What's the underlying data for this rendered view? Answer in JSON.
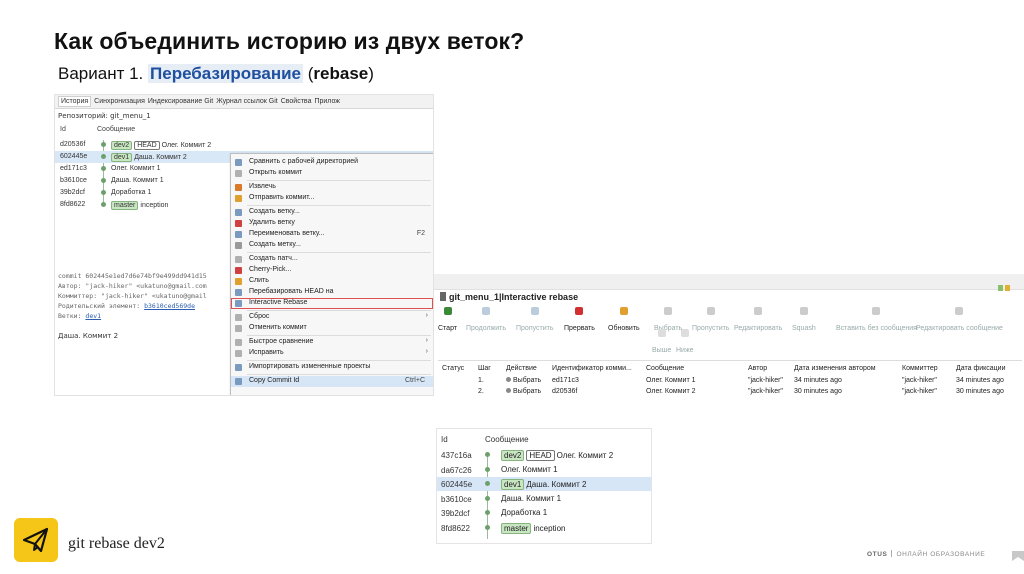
{
  "slide": {
    "title": "Как объединить историю из двух веток?",
    "subtitle_prefix": "Вариант 1.",
    "subtitle_highlight": "Перебазирование",
    "subtitle_open": "(",
    "subtitle_bold": "rebase",
    "subtitle_close": ")",
    "command": "git rebase dev2",
    "brand_left": "OTUS",
    "brand_right": "ОНЛАЙН ОБРАЗОВАНИЕ",
    "colors": {
      "accent_yellow": "#f5c518",
      "highlight_blue": "#1f4fa0",
      "branch_green": "#c9e6c3",
      "selection": "#d9e8f7",
      "red_outline": "#e05050"
    }
  },
  "history_window": {
    "tabs": [
      "История",
      "Синхронизация",
      "Индексирование Git",
      "Журнал ссылок Git",
      "Свойства",
      "Прилож"
    ],
    "repo_label": "Репозиторий: git_menu_1",
    "columns": [
      "Id",
      "Сообщение"
    ],
    "commits": [
      {
        "id": "d20536f",
        "tags": [
          "dev2",
          "HEAD"
        ],
        "message": "Олег. Коммит 2",
        "selected": false
      },
      {
        "id": "602445e",
        "tags": [
          "dev1"
        ],
        "message": "Даша. Коммит 2",
        "selected": true
      },
      {
        "id": "ed171c3",
        "tags": [],
        "message": "Олег. Коммит 1",
        "selected": false
      },
      {
        "id": "b3610ce",
        "tags": [],
        "message": "Даша. Коммит 1",
        "selected": false
      },
      {
        "id": "39b2dcf",
        "tags": [],
        "message": "Доработка 1",
        "selected": false
      },
      {
        "id": "8fd8622",
        "tags": [
          "master"
        ],
        "message": "inception",
        "selected": false
      }
    ],
    "details": {
      "commit_line": "commit 602445e1ed7d6e74bf9e499dd941d15",
      "author_line": "Автор: \"jack-hiker\" <ukatuno@gmail.com",
      "committer_line": "Коммиттер: \"jack-hiker\" <ukatuno@gmail",
      "parent_label": "Родительский элемент:",
      "parent_link": "b3610ced569de",
      "branches_label": "Ветки:",
      "branches_link": "dev1",
      "message": "Даша. Коммит 2"
    },
    "context_menu": [
      {
        "label": "Сравнить с рабочей директорией",
        "icon": "compare-icon",
        "color": "#7a9ac0",
        "shortcut": "",
        "submenu": false
      },
      {
        "label": "Открыть коммит",
        "icon": "open-commit-icon",
        "color": "#b0b0b0",
        "shortcut": "",
        "submenu": false
      },
      {
        "label": "Извлечь",
        "icon": "checkout-icon",
        "color": "#d97a2a",
        "shortcut": "",
        "submenu": false
      },
      {
        "label": "Отправить коммит...",
        "icon": "push-icon",
        "color": "#e0a030",
        "shortcut": "",
        "submenu": false
      },
      {
        "label": "Создать ветку...",
        "icon": "create-branch-icon",
        "color": "#7a9ac0",
        "shortcut": "",
        "submenu": false
      },
      {
        "label": "Удалить ветку",
        "icon": "delete-branch-icon",
        "color": "#d04040",
        "shortcut": "",
        "submenu": false
      },
      {
        "label": "Переименовать ветку...",
        "icon": "rename-branch-icon",
        "color": "#7a9ac0",
        "shortcut": "F2",
        "submenu": false
      },
      {
        "label": "Создать метку...",
        "icon": "tag-icon",
        "color": "#9a9a9a",
        "shortcut": "",
        "submenu": false
      },
      {
        "label": "Создать патч...",
        "icon": "patch-icon",
        "color": "#b0b0b0",
        "shortcut": "",
        "submenu": false
      },
      {
        "label": "Cherry-Pick...",
        "icon": "cherry-pick-icon",
        "color": "#d04040",
        "shortcut": "",
        "submenu": false
      },
      {
        "label": "Слить",
        "icon": "merge-icon",
        "color": "#e0a030",
        "shortcut": "",
        "submenu": false
      },
      {
        "label": "Перебазировать HEAD на",
        "icon": "rebase-icon",
        "color": "#7a9ac0",
        "shortcut": "",
        "submenu": false
      },
      {
        "label": "Interactive Rebase",
        "icon": "interactive-rebase-icon",
        "color": "#7a9ac0",
        "shortcut": "",
        "submenu": false,
        "boxed": true
      },
      {
        "label": "Сброс",
        "icon": "reset-icon",
        "color": "#b0b0b0",
        "shortcut": "",
        "submenu": true
      },
      {
        "label": "Отменить коммит",
        "icon": "revert-icon",
        "color": "#b0b0b0",
        "shortcut": "",
        "submenu": false
      },
      {
        "label": "Быстрое сравнение",
        "icon": "quick-compare-icon",
        "color": "#b0b0b0",
        "shortcut": "",
        "submenu": true
      },
      {
        "label": "Исправить",
        "icon": "fix-icon",
        "color": "#b0b0b0",
        "shortcut": "",
        "submenu": true
      },
      {
        "label": "Импортировать измененные проекты",
        "icon": "import-icon",
        "color": "#7a9ac0",
        "shortcut": "",
        "submenu": false
      },
      {
        "label": "Copy Commit Id",
        "icon": "copy-icon",
        "color": "#7a9ac0",
        "shortcut": "Ctrl+C",
        "submenu": false,
        "highlighted": true
      }
    ]
  },
  "rebase_window": {
    "title": "git_menu_1|Interactive rebase",
    "toolbar": [
      {
        "label": "Старт",
        "icon": "start-icon",
        "color": "#3a8a3a",
        "enabled": true
      },
      {
        "label": "Продолжить",
        "icon": "continue-icon",
        "color": "#bcd",
        "enabled": false
      },
      {
        "label": "Пропустить",
        "icon": "skip-icon",
        "color": "#bcd",
        "enabled": false
      },
      {
        "label": "Прервать",
        "icon": "abort-icon",
        "color": "#d03030",
        "enabled": true
      },
      {
        "label": "Обновить",
        "icon": "refresh-icon",
        "color": "#e0a030",
        "enabled": true
      },
      {
        "label": "Выбрать",
        "icon": "pick-icon",
        "color": "#ccc",
        "enabled": false
      },
      {
        "label": "Пропустить",
        "icon": "skip-commit-icon",
        "color": "#ccc",
        "enabled": false
      },
      {
        "label": "Редактировать",
        "icon": "edit-icon",
        "color": "#ccc",
        "enabled": false
      },
      {
        "label": "Squash",
        "icon": "squash-icon",
        "color": "#ccc",
        "enabled": false
      },
      {
        "label": "Вставить без сообщения",
        "icon": "fixup-icon",
        "color": "#ccc",
        "enabled": false
      },
      {
        "label": "Редактировать сообщение",
        "icon": "reword-icon",
        "color": "#ccc",
        "enabled": false
      }
    ],
    "move_buttons": [
      {
        "label": "Выше",
        "icon": "move-up-icon"
      },
      {
        "label": "Ниже",
        "icon": "move-down-icon"
      }
    ],
    "columns": [
      "Статус",
      "Шаг",
      "Действие",
      "Идентификатор комми...",
      "Сообщение",
      "Автор",
      "Дата изменения автором",
      "Коммиттер",
      "Дата фиксации"
    ],
    "rows": [
      {
        "status": "",
        "step": "1.",
        "action": "Выбрать",
        "id": "ed171c3",
        "message": "Олег. Коммит 1",
        "author": "\"jack-hiker\"",
        "author_date": "34 minutes ago",
        "committer": "\"jack-hiker\"",
        "commit_date": "34 minutes ago"
      },
      {
        "status": "",
        "step": "2.",
        "action": "Выбрать",
        "id": "d20536f",
        "message": "Олег. Коммит 2",
        "author": "\"jack-hiker\"",
        "author_date": "30 minutes ago",
        "committer": "\"jack-hiker\"",
        "commit_date": "30 minutes ago"
      }
    ]
  },
  "result_window": {
    "columns": [
      "Id",
      "Сообщение"
    ],
    "commits": [
      {
        "id": "437c16a",
        "tags": [
          "dev2",
          "HEAD"
        ],
        "message": "Олег. Коммит 2",
        "selected": false
      },
      {
        "id": "da67c26",
        "tags": [],
        "message": "Олег. Коммит 1",
        "selected": false
      },
      {
        "id": "602445e",
        "tags": [
          "dev1"
        ],
        "message": "Даша. Коммит 2",
        "selected": true
      },
      {
        "id": "b3610ce",
        "tags": [],
        "message": "Даша. Коммит 1",
        "selected": false
      },
      {
        "id": "39b2dcf",
        "tags": [],
        "message": "Доработка 1",
        "selected": false
      },
      {
        "id": "8fd8622",
        "tags": [
          "master"
        ],
        "message": "inception",
        "selected": false
      }
    ]
  }
}
